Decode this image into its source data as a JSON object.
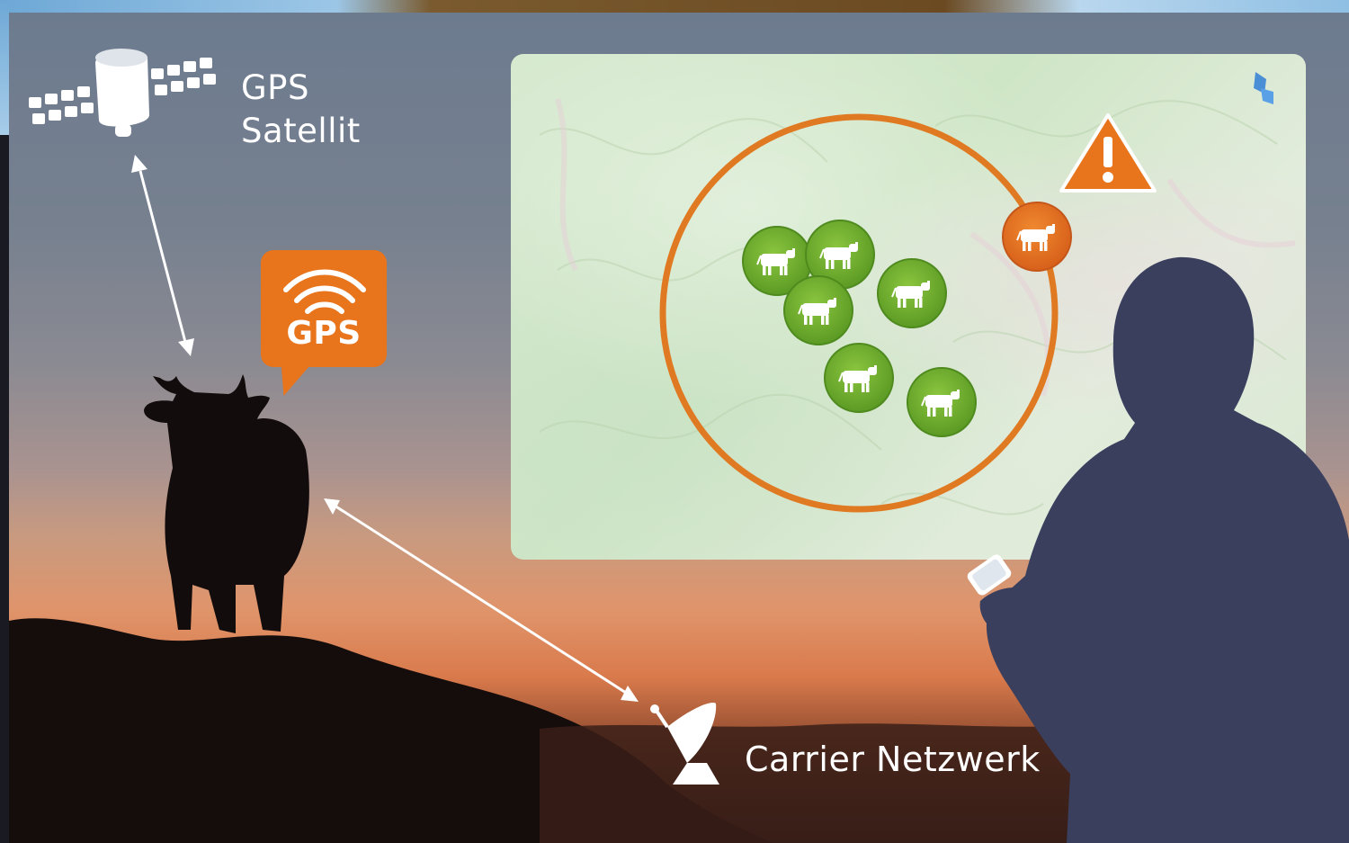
{
  "labels": {
    "satellite_line1": "GPS",
    "satellite_line2": "Satellit",
    "gps_bubble": "GPS",
    "carrier": "Carrier Netzwerk"
  },
  "icons": {
    "satellite": "satellite-icon",
    "wifi": "wifi-signal-icon",
    "dish": "satellite-dish-icon",
    "warning": "warning-icon",
    "cow": "cow-icon",
    "phone": "smartphone-icon"
  },
  "colors": {
    "accent_orange": "#e8741c",
    "herd_green": "#6aa62e",
    "geofence_orange": "#e07a22",
    "person_silhouette": "#3a3f5e",
    "map_green": "#d7ead0"
  },
  "map": {
    "herd_inside": 6,
    "herd_outside": 1
  }
}
